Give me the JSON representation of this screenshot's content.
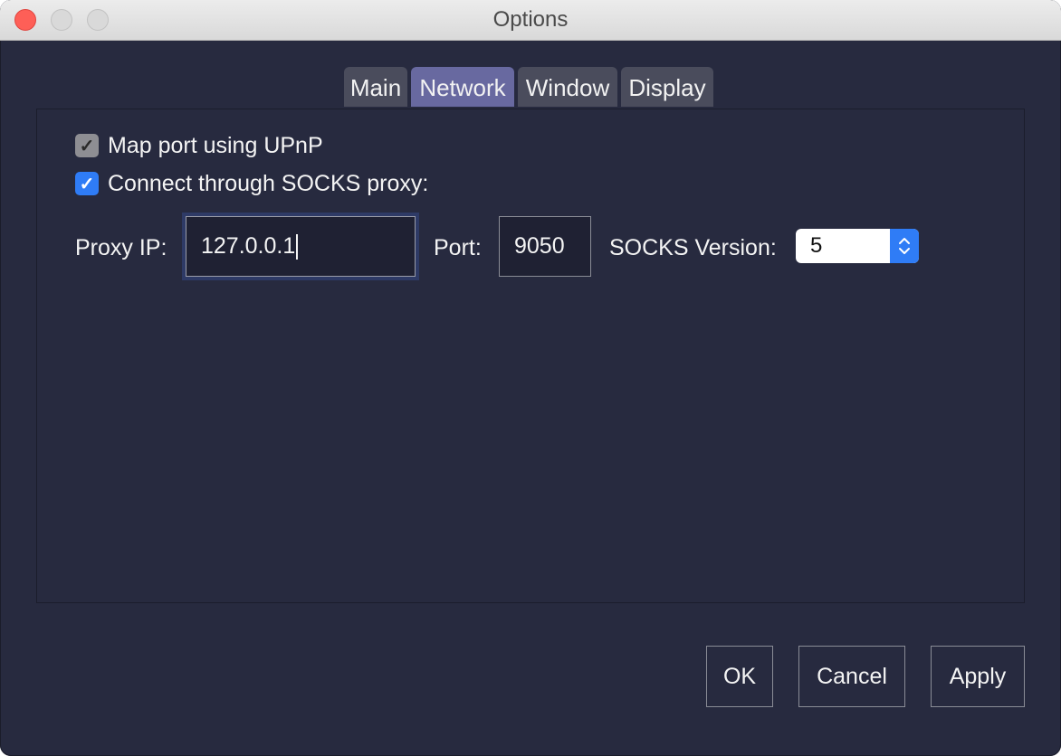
{
  "window": {
    "title": "Options"
  },
  "tabs": [
    {
      "label": "Main",
      "active": false
    },
    {
      "label": "Network",
      "active": true
    },
    {
      "label": "Window",
      "active": false
    },
    {
      "label": "Display",
      "active": false
    }
  ],
  "network": {
    "upnp": {
      "label": "Map port using UPnP",
      "checked": true,
      "enabled": false
    },
    "socks": {
      "label": "Connect through SOCKS proxy:",
      "checked": true
    },
    "proxy_ip": {
      "label": "Proxy IP:",
      "value": "127.0.0.1"
    },
    "port": {
      "label": "Port:",
      "value": "9050"
    },
    "socks_version": {
      "label": "SOCKS Version:",
      "value": "5"
    }
  },
  "buttons": {
    "ok": "OK",
    "cancel": "Cancel",
    "apply": "Apply"
  },
  "colors": {
    "background": "#272a3f",
    "active_tab": "#6869a0",
    "accent": "#2f7cf6"
  },
  "icons": {
    "checkmark": "✓"
  }
}
